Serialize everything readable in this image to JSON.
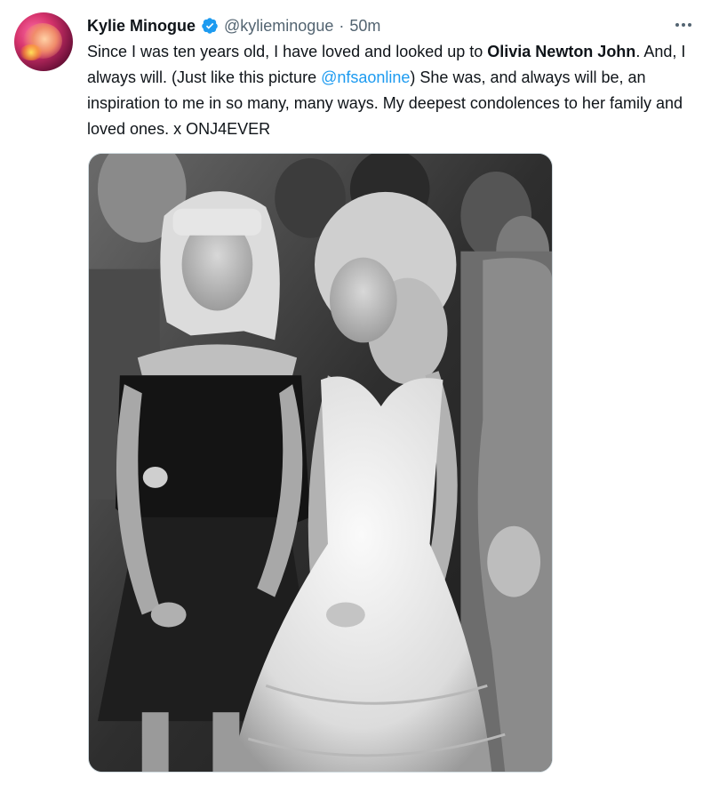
{
  "tweet": {
    "author_name": "Kylie Minogue",
    "handle": "@kylieminogue",
    "separator": "·",
    "time": "50m",
    "text_parts": {
      "p1": "Since I was ten years old, I have loved and looked up to ",
      "bold1": "Olivia Newton John",
      "p2": ". And, I always will.  (Just like this picture ",
      "mention": "@nfsaonline",
      "p3": ") She was, and always will be, an inspiration to me in so many, many ways. My deepest condolences to her family and loved ones. x ONJ4EVER"
    }
  },
  "icons": {
    "verified": "verified-badge-icon",
    "more": "more-options-icon"
  },
  "colors": {
    "link": "#1d9bf0",
    "verified": "#1d9bf0",
    "secondary_text": "#536471"
  }
}
